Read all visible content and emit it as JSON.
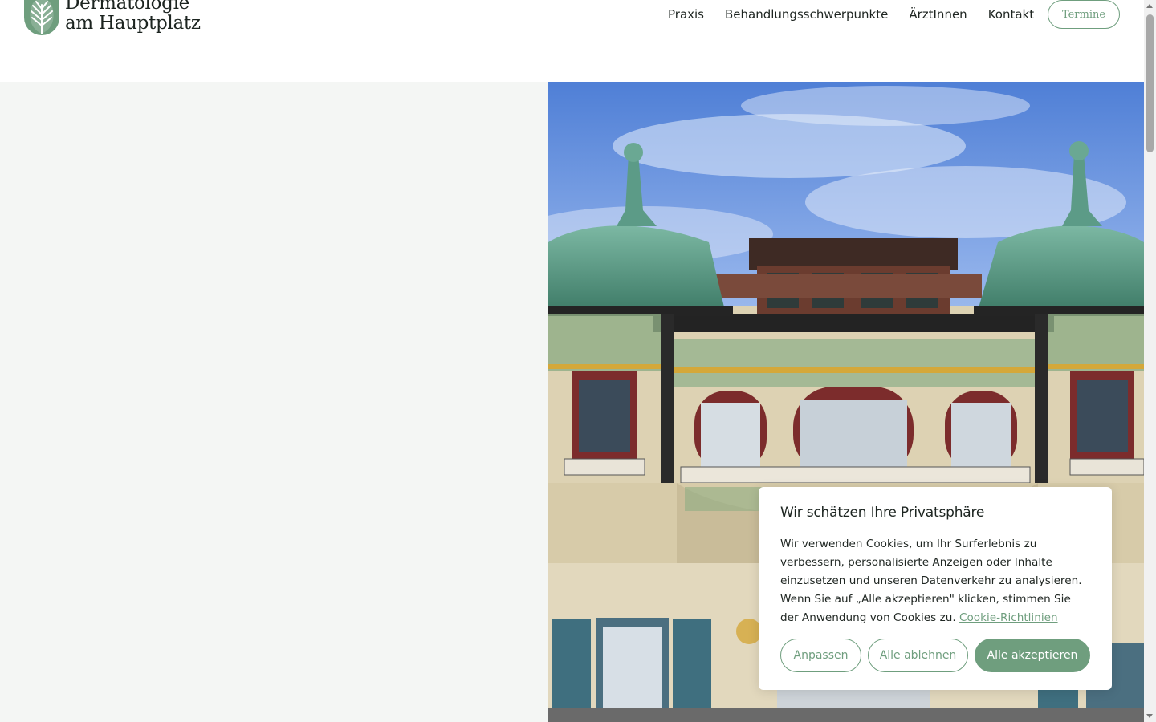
{
  "header": {
    "logo_line1": "Dermatologie",
    "logo_line2": "am Hauptplatz",
    "logo_icon": "leaf-icon",
    "nav": [
      {
        "label": "Praxis"
      },
      {
        "label": "Behandlungsschwerpunkte"
      },
      {
        "label": "ÄrztInnen"
      },
      {
        "label": "Kontakt"
      }
    ],
    "termine_label": "Termine"
  },
  "hero": {
    "image": "art-nouveau-building-facade"
  },
  "cookie": {
    "title": "Wir schätzen Ihre Privatsphäre",
    "text": "Wir verwenden Cookies, um Ihr Surferlebnis zu verbessern, personalisierte Anzeigen oder Inhalte einzusetzen und unseren Datenverkehr zu analysieren. Wenn Sie auf „Alle akzeptieren\" klicken, stimmen Sie der Anwendung von Cookies zu.",
    "link_label": "Cookie-Richtlinien",
    "buttons": {
      "customize": "Anpassen",
      "reject": "Alle ablehnen",
      "accept": "Alle akzeptieren"
    }
  },
  "colors": {
    "accent": "#6f9e7e",
    "panel": "#f4f6f4",
    "text": "#1f2622"
  }
}
